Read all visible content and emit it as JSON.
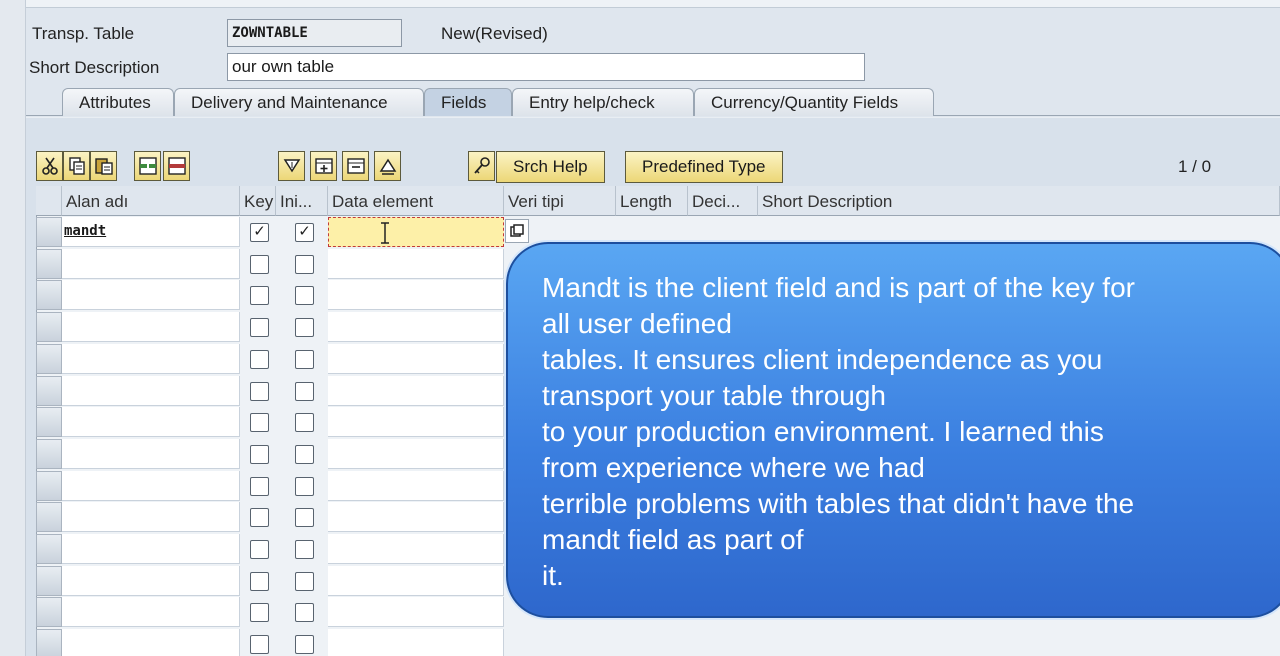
{
  "header": {
    "transp_table_label": "Transp. Table",
    "transp_table_value": "ZOWNTABLE",
    "status": "New(Revised)",
    "short_desc_label": "Short Description",
    "short_desc_value": "our own table"
  },
  "tabs": [
    {
      "label": "Attributes",
      "active": false
    },
    {
      "label": "Delivery and Maintenance",
      "active": false
    },
    {
      "label": "Fields",
      "active": true
    },
    {
      "label": "Entry help/check",
      "active": false
    },
    {
      "label": "Currency/Quantity Fields",
      "active": false
    }
  ],
  "toolbar": {
    "cut_icon": "scissors-icon",
    "copy_icon": "copy-icon",
    "paste_icon": "paste-icon",
    "insert_row_icon": "insert-row-icon",
    "delete_row_icon": "delete-row-icon",
    "move_down_icon": "move-down-icon",
    "insert_block_icon": "insert-block-icon",
    "select_block_icon": "select-block-icon",
    "move_up_icon": "move-up-icon",
    "key_icon": "key-icon",
    "srch_help_label": "Srch Help",
    "predefined_type_label": "Predefined Type",
    "counter": "1 / 0"
  },
  "columns": {
    "field_name": "Alan adı",
    "key": "Key",
    "initial": "Ini...",
    "data_element": "Data element",
    "data_type": "Veri tipi",
    "length": "Length",
    "decimals": "Deci...",
    "short_description": "Short Description"
  },
  "rows": [
    {
      "field_name": "mandt",
      "key": true,
      "initial": true
    },
    {
      "field_name": "",
      "key": false,
      "initial": false
    },
    {
      "field_name": "",
      "key": false,
      "initial": false
    },
    {
      "field_name": "",
      "key": false,
      "initial": false
    },
    {
      "field_name": "",
      "key": false,
      "initial": false
    },
    {
      "field_name": "",
      "key": false,
      "initial": false
    },
    {
      "field_name": "",
      "key": false,
      "initial": false
    },
    {
      "field_name": "",
      "key": false,
      "initial": false
    },
    {
      "field_name": "",
      "key": false,
      "initial": false
    },
    {
      "field_name": "",
      "key": false,
      "initial": false
    },
    {
      "field_name": "",
      "key": false,
      "initial": false
    },
    {
      "field_name": "",
      "key": false,
      "initial": false
    },
    {
      "field_name": "",
      "key": false,
      "initial": false
    },
    {
      "field_name": "",
      "key": false,
      "initial": false
    }
  ],
  "checkmark": "✓",
  "tooltip": {
    "text": "Mandt is the client field and is part of the key for\nall user defined\ntables. It ensures client independence as you\ntransport your table through\nto your production environment. I learned this\nfrom experience where we had\nterrible problems with tables that didn't have the\nmandt field as part of\nit."
  },
  "colors": {
    "tooltip_blue": "#3b7fe0",
    "button_yellow": "#ecd777",
    "focus_yellow": "#fdf0a8"
  }
}
